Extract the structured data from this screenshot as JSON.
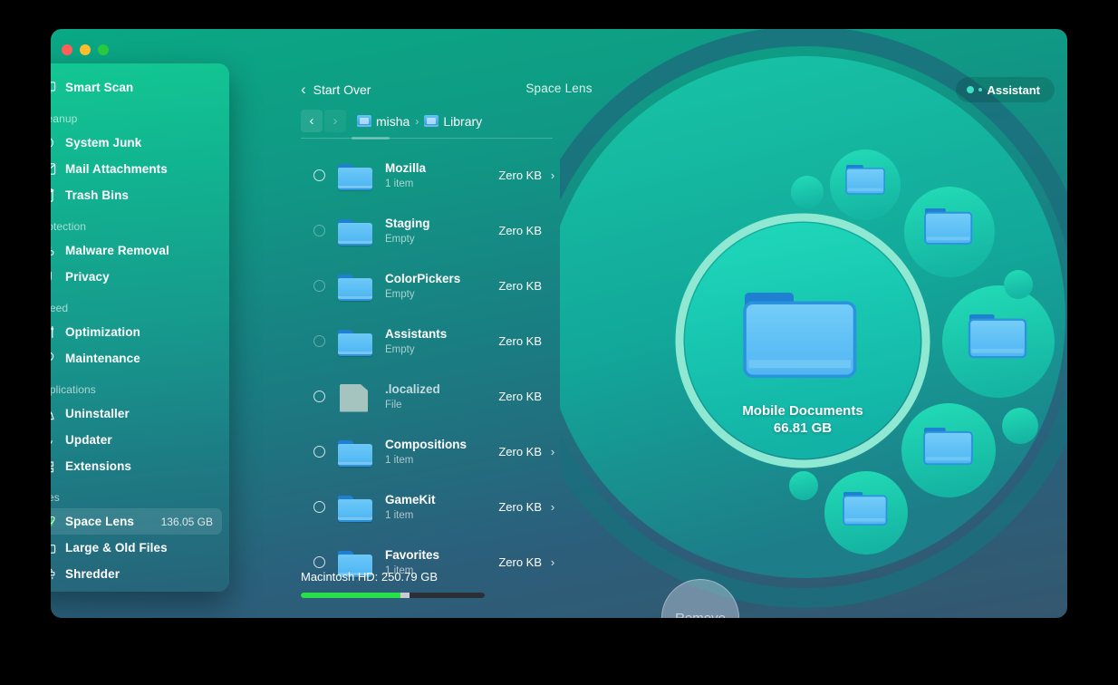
{
  "window": {
    "title": "Space Lens",
    "assistant_label": "Assistant",
    "traffic": [
      "close",
      "minimize",
      "zoom"
    ]
  },
  "sidebar": {
    "top_item": {
      "label": "Smart Scan",
      "icon": "monitor-scan-icon"
    },
    "groups": [
      {
        "title": "Cleanup",
        "items": [
          {
            "label": "System Junk",
            "icon": "broom-icon"
          },
          {
            "label": "Mail Attachments",
            "icon": "envelope-icon"
          },
          {
            "label": "Trash Bins",
            "icon": "trash-icon"
          }
        ]
      },
      {
        "title": "Protection",
        "items": [
          {
            "label": "Malware Removal",
            "icon": "biohazard-icon"
          },
          {
            "label": "Privacy",
            "icon": "hand-icon"
          }
        ]
      },
      {
        "title": "Speed",
        "items": [
          {
            "label": "Optimization",
            "icon": "sliders-icon"
          },
          {
            "label": "Maintenance",
            "icon": "wrench-icon"
          }
        ]
      },
      {
        "title": "Applications",
        "items": [
          {
            "label": "Uninstaller",
            "icon": "uninstaller-icon"
          },
          {
            "label": "Updater",
            "icon": "updater-arrow-icon"
          },
          {
            "label": "Extensions",
            "icon": "puzzle-icon"
          }
        ]
      },
      {
        "title": "Files",
        "items": [
          {
            "label": "Space Lens",
            "icon": "planet-icon",
            "size": "136.05 GB",
            "active": true
          },
          {
            "label": "Large & Old Files",
            "icon": "folder-outline-icon"
          },
          {
            "label": "Shredder",
            "icon": "shredder-icon"
          }
        ]
      }
    ]
  },
  "list_panel": {
    "start_over": "Start Over",
    "nav": {
      "back": "‹",
      "forward": "›"
    },
    "breadcrumbs": [
      {
        "label": "misha",
        "icon": "home-folder-icon"
      },
      {
        "label": "Library",
        "icon": "library-folder-icon"
      }
    ],
    "breadcrumb_separator": "›",
    "rows": [
      {
        "name": "Mozilla",
        "sub": "1 item",
        "size": "Zero KB",
        "type": "folder",
        "chevron": true,
        "checked": false
      },
      {
        "name": "Staging",
        "sub": "Empty",
        "size": "Zero KB",
        "type": "folder",
        "chevron": false,
        "checked": false
      },
      {
        "name": "ColorPickers",
        "sub": "Empty",
        "size": "Zero KB",
        "type": "folder",
        "chevron": false,
        "checked": false
      },
      {
        "name": "Assistants",
        "sub": "Empty",
        "size": "Zero KB",
        "type": "folder",
        "chevron": false,
        "checked": false
      },
      {
        "name": ".localized",
        "sub": "File",
        "size": "Zero KB",
        "type": "file",
        "chevron": false,
        "checked": false
      },
      {
        "name": "Compositions",
        "sub": "1 item",
        "size": "Zero KB",
        "type": "folder",
        "chevron": true,
        "checked": false
      },
      {
        "name": "GameKit",
        "sub": "1 item",
        "size": "Zero KB",
        "type": "folder",
        "chevron": true,
        "checked": false
      },
      {
        "name": "Favorites",
        "sub": "1 item",
        "size": "Zero KB",
        "type": "folder",
        "chevron": true,
        "checked": false
      }
    ],
    "disk": {
      "label": "Macintosh HD: 250.79 GB",
      "used_percent": 54,
      "mid_percent": 5
    }
  },
  "visualization": {
    "center_bubble": {
      "name": "Mobile Documents",
      "size": "66.81 GB"
    }
  },
  "actions": {
    "remove_label": "Remove"
  },
  "colors": {
    "accent_green": "#12c793",
    "teal": "#13b8a0",
    "folder_blue": "#59bdf5",
    "disk_used": "#2ae04a",
    "window_top": "#0aa884",
    "window_bottom": "#34576f"
  }
}
